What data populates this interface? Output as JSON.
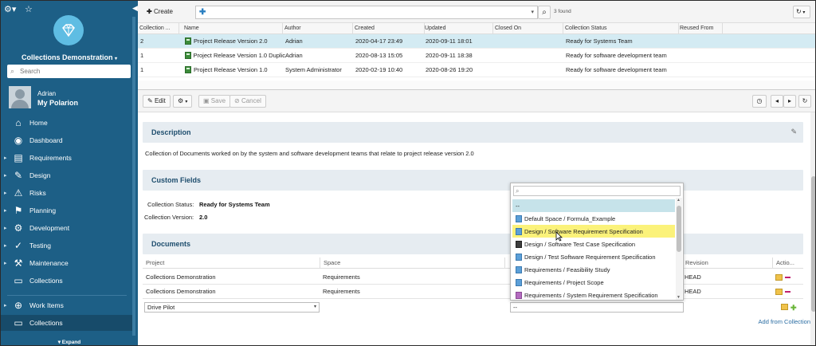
{
  "sidebar": {
    "project": "Collections Demonstration",
    "search_placeholder": "Search",
    "user_name": "Adrian",
    "my_polarion": "My Polarion",
    "nav": [
      {
        "label": "Home",
        "icon": "home-icon",
        "arrow": false
      },
      {
        "label": "Dashboard",
        "icon": "dashboard-icon",
        "arrow": false
      },
      {
        "label": "Requirements",
        "icon": "requirements-icon",
        "arrow": true
      },
      {
        "label": "Design",
        "icon": "design-icon",
        "arrow": true
      },
      {
        "label": "Risks",
        "icon": "risks-icon",
        "arrow": true
      },
      {
        "label": "Planning",
        "icon": "planning-icon",
        "arrow": true
      },
      {
        "label": "Development",
        "icon": "development-icon",
        "arrow": true
      },
      {
        "label": "Testing",
        "icon": "testing-icon",
        "arrow": true
      },
      {
        "label": "Maintenance",
        "icon": "maintenance-icon",
        "arrow": true
      },
      {
        "label": "Collections",
        "icon": "collections-icon",
        "arrow": false
      },
      {
        "label": "Work Items",
        "icon": "work-items-icon",
        "arrow": true
      },
      {
        "label": "Collections",
        "icon": "collections-icon",
        "arrow": false
      }
    ],
    "expand": "Expand"
  },
  "toolbar": {
    "create": "Create",
    "found": "3 found"
  },
  "grid": {
    "headers": [
      "Collection ...",
      "Name",
      "Author",
      "Created",
      "Updated",
      "Closed On",
      "Collection Status",
      "Reused From"
    ],
    "rows": [
      {
        "id": "2",
        "name": "Project Release Version 2.0",
        "author": "Adrian",
        "created": "2020-04-17 23:49",
        "updated": "2020-09-11 18:01",
        "closed": "",
        "status": "Ready for Systems Team"
      },
      {
        "id": "1",
        "name": "Project Release Version 1.0 Duplic",
        "author": "Adrian",
        "created": "2020-08-13 15:05",
        "updated": "2020-09-11 18:38",
        "closed": "",
        "status": "Ready for software development team"
      },
      {
        "id": "1",
        "name": "Project Release Version 1.0",
        "author": "System Administrator",
        "created": "2020-02-19 10:40",
        "updated": "2020-08-26 19:20",
        "closed": "",
        "status": "Ready for software development team"
      }
    ]
  },
  "detail_toolbar": {
    "edit": "Edit",
    "save": "Save",
    "cancel": "Cancel"
  },
  "description": {
    "title": "Description",
    "text": "Collection of Documents worked on by the system and software development teams that relate to project release version 2.0"
  },
  "custom_fields": {
    "title": "Custom Fields",
    "status_label": "Collection Status:",
    "status_value": "Ready for Systems Team",
    "version_label": "Collection Version:",
    "version_value": "2.0"
  },
  "documents": {
    "title": "Documents",
    "headers": [
      "Project",
      "Space",
      "",
      "Revision",
      "Actio..."
    ],
    "rows": [
      {
        "project": "Collections Demonstration",
        "space": "Requirements",
        "revision": "HEAD"
      },
      {
        "project": "Collections Demonstration",
        "space": "Requirements",
        "revision": "HEAD"
      }
    ],
    "new_project": "Drive Pilot",
    "new_doc": "--",
    "add_link": "Add from Collection"
  },
  "dropdown": {
    "items": [
      {
        "label": "--",
        "type": "none"
      },
      {
        "label": "Default Space / Formula_Example",
        "type": "doc"
      },
      {
        "label": "Design / Software Requirement Specification",
        "type": "doc"
      },
      {
        "label": "Design / Software Test Case Specification",
        "type": "tc"
      },
      {
        "label": "Design / Test Software Requirement Specification",
        "type": "doc"
      },
      {
        "label": "Requirements / Feasibility Study",
        "type": "doc"
      },
      {
        "label": "Requirements / Project Scope",
        "type": "doc"
      },
      {
        "label": "Requirements / System Requirement Specification",
        "type": "sp"
      }
    ]
  }
}
